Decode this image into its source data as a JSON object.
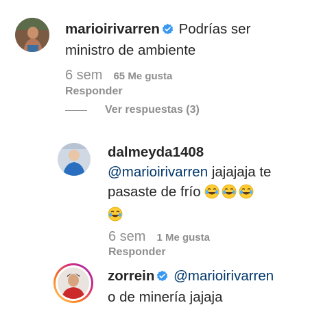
{
  "comments": [
    {
      "username": "marioirivarren",
      "verified": true,
      "text_line1": "Podrías ser",
      "text_line2": "ministro de ambiente",
      "time": "6 sem",
      "likes": "65 Me gusta",
      "reply_label": "Responder",
      "view_replies_label": "Ver respuestas (3)"
    },
    {
      "username": "dalmeyda1408",
      "mention": "@marioirivarren",
      "text_line1_rest": "jajajaja te",
      "text_line2": "pasaste de frío",
      "emojis": [
        "face-with-tears-of-joy-icon",
        "face-with-tears-of-joy-icon",
        "face-with-tears-of-joy-icon",
        "face-with-tears-of-joy-icon"
      ],
      "time": "6 sem",
      "likes": "1 Me gusta",
      "reply_label": "Responder"
    },
    {
      "username": "zorrein",
      "verified": true,
      "mention": "@marioirivarren",
      "text_line2": "o de minería jajaja"
    }
  ],
  "colors": {
    "text": "#262626",
    "secondary": "#8e8e8e",
    "mention": "#00376b",
    "verified_badge": "#3897f0",
    "story_ring_start": "#feda75",
    "story_ring_end": "#d62976"
  }
}
